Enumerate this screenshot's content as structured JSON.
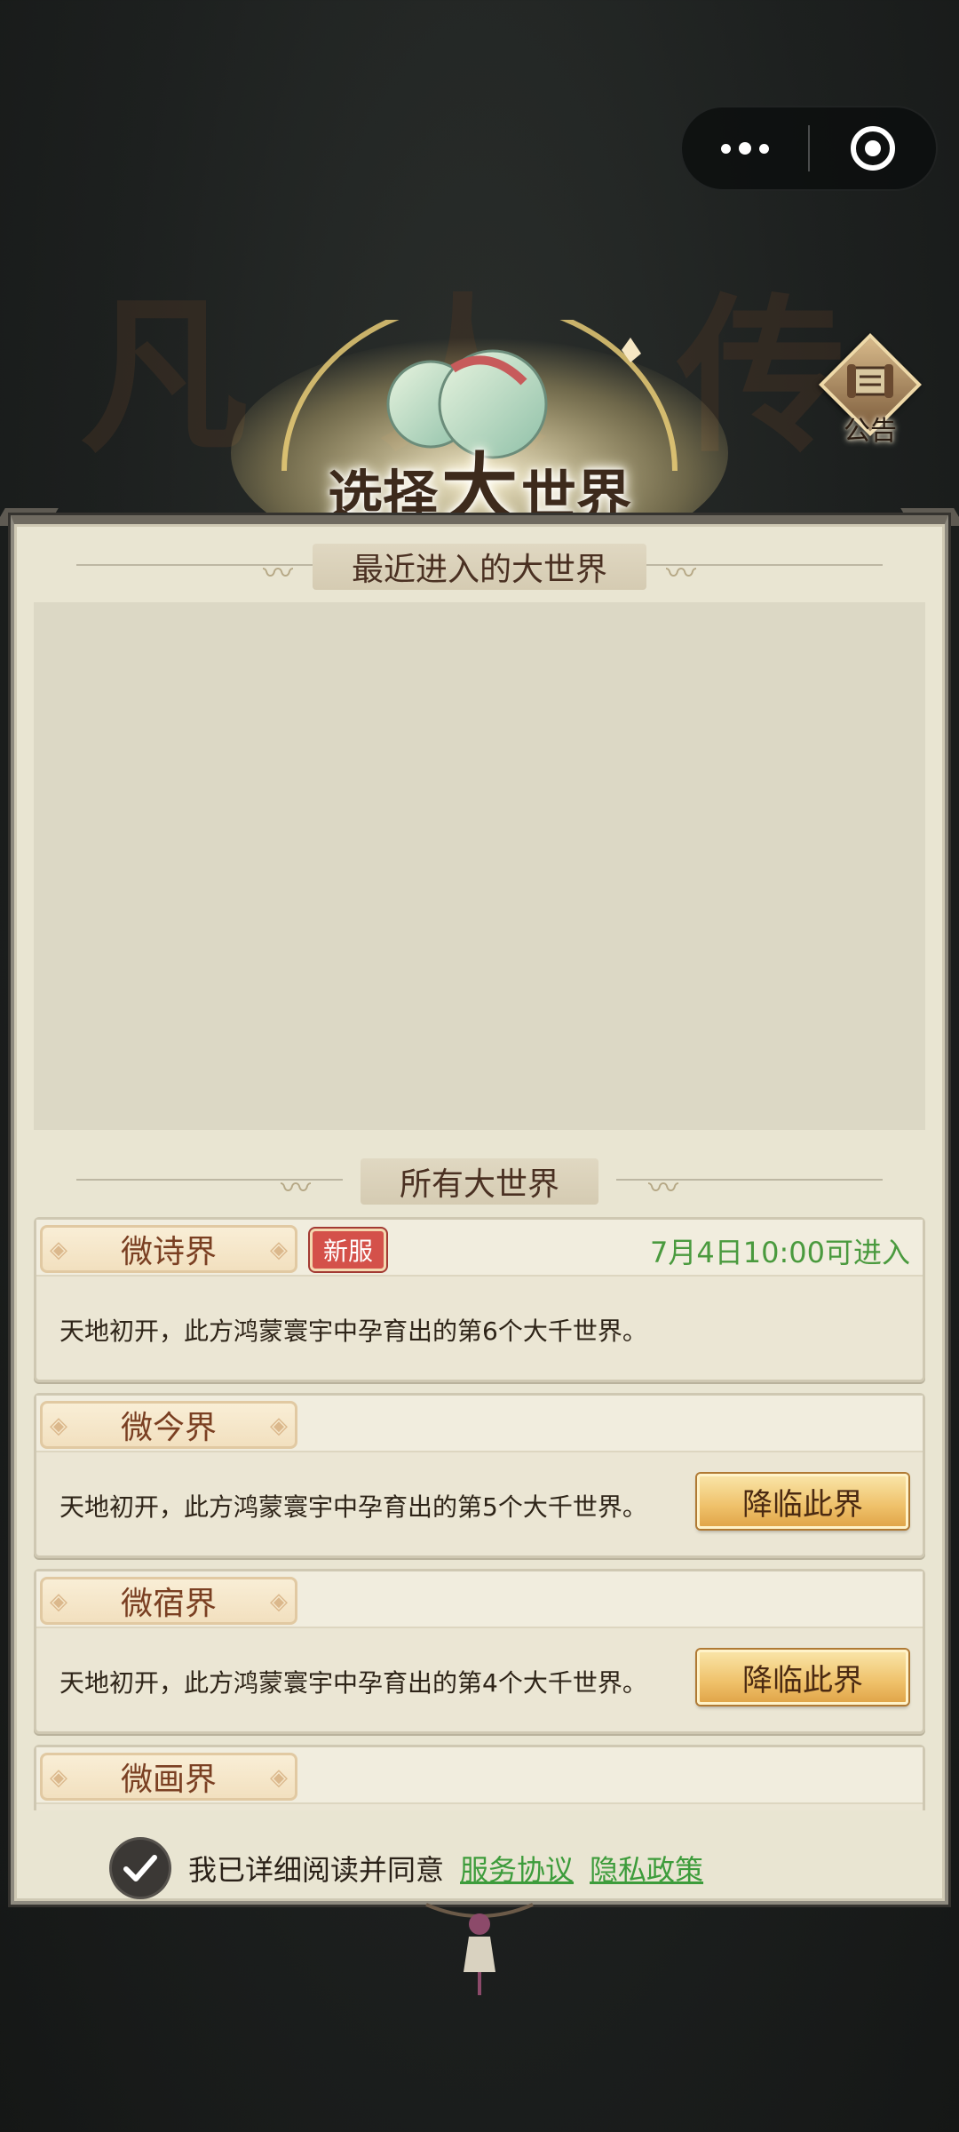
{
  "menu_capsule": {
    "more_icon": "dots-icon",
    "close_icon": "target-circle-icon"
  },
  "background_calligraphy": "凡 人 传 说",
  "title": {
    "part1": "选择",
    "part2": "大",
    "part3": "世界"
  },
  "notice": {
    "label": "公告",
    "icon": "scroll-icon"
  },
  "recent_section": {
    "title": "最近进入的大世界"
  },
  "all_section": {
    "title": "所有大世界"
  },
  "worlds": [
    {
      "name": "微诗界",
      "badge": "新服",
      "open_time": "7月4日10:00可进入",
      "desc": "天地初开，此方鸿蒙寰宇中孕育出的第6个大千世界。"
    },
    {
      "name": "微今界",
      "desc": "天地初开，此方鸿蒙寰宇中孕育出的第5个大千世界。",
      "button": "降临此界"
    },
    {
      "name": "微宿界",
      "desc": "天地初开，此方鸿蒙寰宇中孕育出的第4个大千世界。",
      "button": "降临此界"
    },
    {
      "name": "微画界"
    }
  ],
  "agreement": {
    "text": "我已详细阅读并同意",
    "service": "服务协议",
    "privacy": "隐私政策",
    "checked": true
  },
  "colors": {
    "link_green": "#3d9c3b",
    "panel_bg": "#e9e5d2",
    "badge_red": "#d4514a",
    "button_gold": "#efc16a"
  }
}
